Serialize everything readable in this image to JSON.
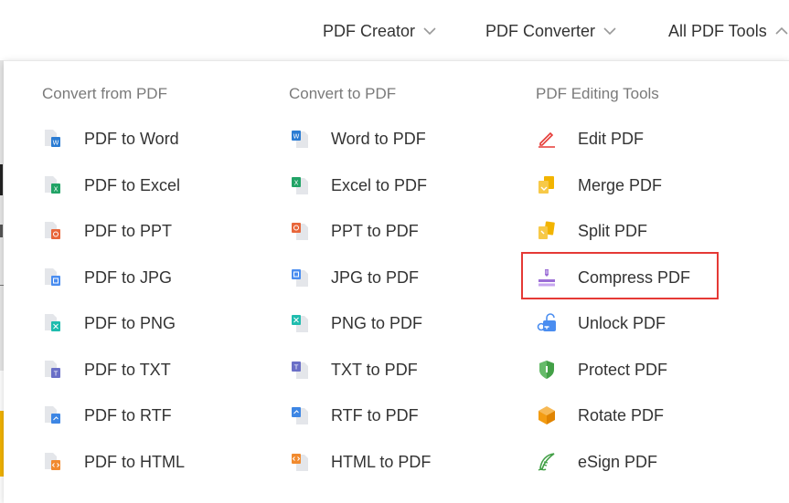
{
  "topnav": {
    "items": [
      {
        "label": "PDF Creator",
        "expanded": false
      },
      {
        "label": "PDF Converter",
        "expanded": false
      },
      {
        "label": "All PDF Tools",
        "expanded": true
      }
    ]
  },
  "dropdown": {
    "columns": [
      {
        "title": "Convert from PDF",
        "items": [
          {
            "label": "PDF to Word",
            "icon": "file-word-icon",
            "color": "#2b7cd3"
          },
          {
            "label": "PDF to Excel",
            "icon": "file-excel-icon",
            "color": "#21a366"
          },
          {
            "label": "PDF to PPT",
            "icon": "file-ppt-icon",
            "color": "#e8663a"
          },
          {
            "label": "PDF to JPG",
            "icon": "file-jpg-icon",
            "color": "#4a8df0"
          },
          {
            "label": "PDF to PNG",
            "icon": "file-png-icon",
            "color": "#1fbcae"
          },
          {
            "label": "PDF to TXT",
            "icon": "file-txt-icon",
            "color": "#6a6fc7"
          },
          {
            "label": "PDF to RTF",
            "icon": "file-rtf-icon",
            "color": "#3d86e4"
          },
          {
            "label": "PDF to HTML",
            "icon": "file-html-icon",
            "color": "#f18a2e"
          }
        ]
      },
      {
        "title": "Convert to PDF",
        "items": [
          {
            "label": "Word to PDF",
            "icon": "word-file-icon",
            "color": "#2b7cd3"
          },
          {
            "label": "Excel to PDF",
            "icon": "excel-file-icon",
            "color": "#21a366"
          },
          {
            "label": "PPT to PDF",
            "icon": "ppt-file-icon",
            "color": "#e8663a"
          },
          {
            "label": "JPG to PDF",
            "icon": "jpg-file-icon",
            "color": "#4a8df0"
          },
          {
            "label": "PNG to PDF",
            "icon": "png-file-icon",
            "color": "#1fbcae"
          },
          {
            "label": "TXT to PDF",
            "icon": "txt-file-icon",
            "color": "#6a6fc7"
          },
          {
            "label": "RTF to PDF",
            "icon": "rtf-file-icon",
            "color": "#3d86e4"
          },
          {
            "label": "HTML to PDF",
            "icon": "html-file-icon",
            "color": "#f18a2e"
          }
        ]
      },
      {
        "title": "PDF Editing Tools",
        "items": [
          {
            "label": "Edit PDF",
            "icon": "pen-edit-icon",
            "color": "#e53935"
          },
          {
            "label": "Merge PDF",
            "icon": "merge-icon",
            "color": "#f2b400"
          },
          {
            "label": "Split PDF",
            "icon": "split-icon",
            "color": "#f2b400"
          },
          {
            "label": "Compress PDF",
            "icon": "compress-icon",
            "color": "#9b6dd6"
          },
          {
            "label": "Unlock PDF",
            "icon": "unlock-icon",
            "color": "#4a8df0"
          },
          {
            "label": "Protect PDF",
            "icon": "shield-icon",
            "color": "#43a047"
          },
          {
            "label": "Rotate PDF",
            "icon": "cube-rotate-icon",
            "color": "#f39c12"
          },
          {
            "label": "eSign PDF",
            "icon": "feather-sign-icon",
            "color": "#43a047"
          }
        ]
      }
    ],
    "highlighted_item": "Compress PDF",
    "highlight_color": "#e53935"
  }
}
